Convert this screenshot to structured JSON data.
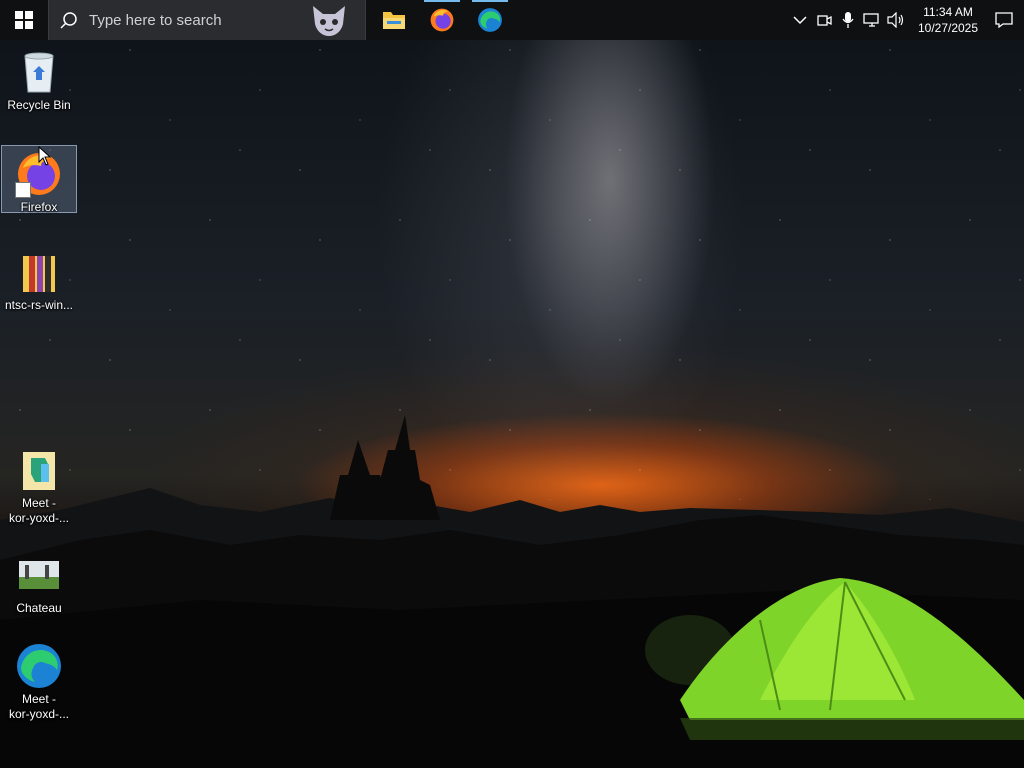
{
  "taskbar": {
    "search_placeholder": "Type here to search",
    "pinned_apps": [
      {
        "name": "File Explorer",
        "icon": "folder-icon"
      },
      {
        "name": "Firefox",
        "icon": "firefox-icon"
      },
      {
        "name": "Microsoft Edge",
        "icon": "edge-icon"
      }
    ],
    "clock": {
      "time": "11:34 AM",
      "date": "10/27/2025"
    },
    "accent_color": "#76b9ed"
  },
  "desktop": {
    "icons": [
      {
        "label": "Recycle Bin",
        "icon": "recycle-bin-icon"
      },
      {
        "label": "Firefox",
        "icon": "firefox-icon",
        "selected": true
      },
      {
        "label": "ntsc-rs-win...",
        "icon": "archive-icon"
      },
      {
        "label_line1": "Meet -",
        "label_line2": "kor-yoxd-...",
        "icon": "meet-shortcut-icon"
      },
      {
        "label": "Chateau",
        "icon": "chateau-icon"
      },
      {
        "label_line1": "Meet -",
        "label_line2": "kor-yoxd-...",
        "icon": "edge-icon"
      }
    ]
  }
}
